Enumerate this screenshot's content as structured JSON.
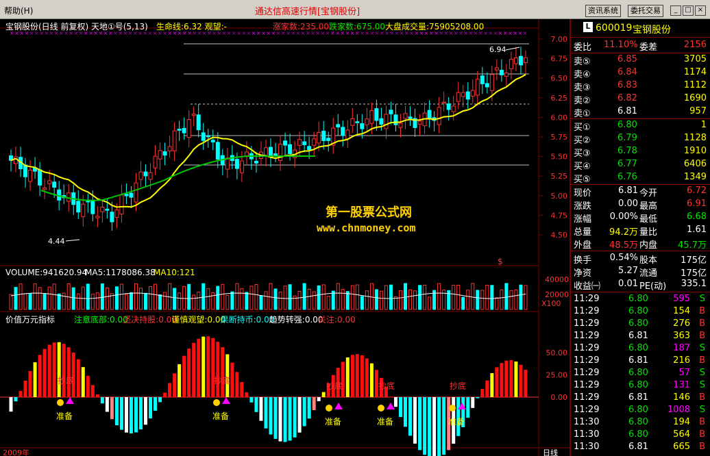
{
  "menu": {
    "help": "帮助(H)",
    "title": "通达信高速行情[宝钢股份]",
    "news_btn": "资讯系统",
    "trade_btn": "委托交易",
    "min": "_",
    "max": "□",
    "close": "×"
  },
  "price_panel": {
    "header": "宝钢股份(日线 前复权) 天地①号(5,13)",
    "lifeline": "生命线:6.32 观望:-",
    "rise": "涨家数:235.00",
    "fall": "跌家数:675.00",
    "volume_total": "大盘成交量:75905208.00",
    "y_ticks": [
      "7.00",
      "6.75",
      "6.50",
      "6.25",
      "6.00",
      "5.75",
      "5.50",
      "5.25",
      "5.00",
      "4.75",
      "4.50"
    ],
    "high_label": "6.94",
    "low_label": "4.44",
    "dollar": "$"
  },
  "volume_panel": {
    "vol": "VOLUME:941620.94",
    "ma5": "MA5:1178086.38",
    "ma10": "MA10:121",
    "y_ticks": [
      "40000",
      "20000"
    ],
    "unit": "X100"
  },
  "indicator_panel": {
    "name": "价值万元指标",
    "items": [
      {
        "label": "注意底部:0.00",
        "color": "#00ff00"
      },
      {
        "label": "坚决持股:0.00",
        "color": "#ff3232"
      },
      {
        "label": "谨慎观望:0.00",
        "color": "#ffff00"
      },
      {
        "label": "果断持币:0.00",
        "color": "#00ffff"
      },
      {
        "label": "趋势转强:0.00",
        "color": "#ffffff"
      },
      {
        "label": "关注:0.00",
        "color": "#ff3232"
      }
    ],
    "y_ticks": [
      "50.00",
      "25.00",
      "0.00"
    ],
    "signals": [
      "抄底",
      "准备"
    ]
  },
  "watermark": {
    "line1": "第一股票公式网",
    "line2": "www.chnmoney.com"
  },
  "bottom": {
    "left": "2009年",
    "right": "日线"
  },
  "quote": {
    "code": "600019",
    "name": "宝钢股份",
    "badge": "L",
    "wb_label": "委比",
    "wb_val": "11.10%",
    "wc_label": "委差",
    "wc_val": "2156",
    "sells": [
      {
        "label": "卖⑤",
        "price": "6.85",
        "vol": "3705"
      },
      {
        "label": "卖④",
        "price": "6.84",
        "vol": "1174"
      },
      {
        "label": "卖③",
        "price": "6.83",
        "vol": "1112"
      },
      {
        "label": "卖②",
        "price": "6.82",
        "vol": "1690"
      },
      {
        "label": "卖①",
        "price": "6.81",
        "vol": "957"
      }
    ],
    "buys": [
      {
        "label": "买①",
        "price": "6.80",
        "vol": "1"
      },
      {
        "label": "买②",
        "price": "6.79",
        "vol": "1128"
      },
      {
        "label": "买③",
        "price": "6.78",
        "vol": "1910"
      },
      {
        "label": "买④",
        "price": "6.77",
        "vol": "6406"
      },
      {
        "label": "买⑤",
        "price": "6.76",
        "vol": "1349"
      }
    ],
    "stats": [
      {
        "l1": "现价",
        "v1": "6.81",
        "c1": "wht",
        "l2": "今开",
        "v2": "6.72",
        "c2": "red"
      },
      {
        "l1": "涨跌",
        "v1": "0.00",
        "c1": "wht",
        "l2": "最高",
        "v2": "6.91",
        "c2": "red"
      },
      {
        "l1": "涨幅",
        "v1": "0.00%",
        "c1": "wht",
        "l2": "最低",
        "v2": "6.68",
        "c2": "grn"
      },
      {
        "l1": "总量",
        "v1": "94.2万",
        "c1": "yel",
        "l2": "量比",
        "v2": "1.61",
        "c2": "wht"
      },
      {
        "l1": "外盘",
        "v1": "48.5万",
        "c1": "red",
        "l2": "内盘",
        "v2": "45.7万",
        "c2": "grn"
      }
    ],
    "stats2": [
      {
        "l1": "换手",
        "v1": "0.54%",
        "l2": "股本",
        "v2": "175亿"
      },
      {
        "l1": "净资",
        "v1": "5.27",
        "l2": "流通",
        "v2": "175亿"
      },
      {
        "l1": "收益㈠",
        "v1": "0.01",
        "l2": "PE(动)",
        "v2": "335.1"
      }
    ],
    "ticks": [
      {
        "t": "11:29",
        "p": "6.80",
        "v": "595",
        "s": "S"
      },
      {
        "t": "11:29",
        "p": "6.80",
        "v": "154",
        "s": "B"
      },
      {
        "t": "11:29",
        "p": "6.80",
        "v": "276",
        "s": "B"
      },
      {
        "t": "11:29",
        "p": "6.81",
        "v": "363",
        "s": "B"
      },
      {
        "t": "11:29",
        "p": "6.80",
        "v": "187",
        "s": "S"
      },
      {
        "t": "11:29",
        "p": "6.81",
        "v": "216",
        "s": "B"
      },
      {
        "t": "11:29",
        "p": "6.80",
        "v": "57",
        "s": "S"
      },
      {
        "t": "11:29",
        "p": "6.80",
        "v": "131",
        "s": "S"
      },
      {
        "t": "11:29",
        "p": "6.81",
        "v": "146",
        "s": "B"
      },
      {
        "t": "11:29",
        "p": "6.80",
        "v": "1008",
        "s": "S"
      },
      {
        "t": "11:30",
        "p": "6.80",
        "v": "194",
        "s": "B"
      },
      {
        "t": "11:30",
        "p": "6.80",
        "v": "564",
        "s": "B"
      },
      {
        "t": "11:30",
        "p": "6.81",
        "v": "665",
        "s": "B"
      }
    ]
  },
  "colors": {
    "up": "#ff3232",
    "down": "#00ffff",
    "ma_yellow": "#ffff00",
    "ma_green": "#00c800",
    "grid": "#7a0000"
  }
}
